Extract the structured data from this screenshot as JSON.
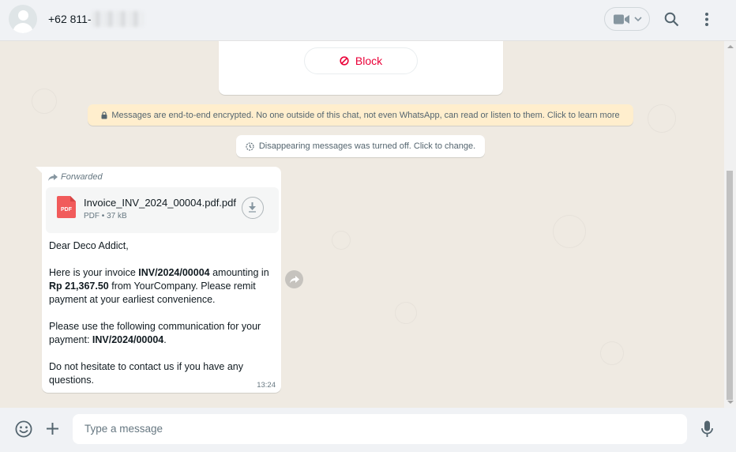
{
  "header": {
    "contact_number": "+62 811-",
    "icons": [
      "default-avatar-icon",
      "video-call-icon",
      "chevron-down-icon",
      "search-icon",
      "menu-dots-icon"
    ]
  },
  "card": {
    "block_label": "Block",
    "block_color": "#ea0038"
  },
  "system": {
    "encryption_notice": "Messages are end-to-end encrypted. No one outside of this chat, not even WhatsApp, can read or listen to them. Click to learn more",
    "disappearing_notice": "Disappearing messages was turned off. Click to change."
  },
  "message": {
    "forwarded_label": "Forwarded",
    "document": {
      "name": "Invoice_INV_2024_00004.pdf.pdf",
      "type": "PDF",
      "size": "37 kB",
      "icon": "pdf-file-icon"
    },
    "greeting": "Dear Deco Addict,",
    "p2_a": "Here is your invoice ",
    "p2_invoice": "INV/2024/00004",
    "p2_b": " amounting in ",
    "p2_amount": "Rp 21,367.50",
    "p2_c": " from YourCompany. Please remit payment at your earliest convenience.",
    "p3_a": "Please use the following communication for your payment: ",
    "p3_ref": "INV/2024/00004",
    "p3_b": ".",
    "p4": "Do not hesitate to contact us if you have any questions.",
    "time": "13:24"
  },
  "composer": {
    "placeholder": "Type a message"
  },
  "colors": {
    "chat_bg": "#efeae2",
    "header_bg": "#f0f2f5",
    "encryption_bg": "#ffeecd"
  }
}
